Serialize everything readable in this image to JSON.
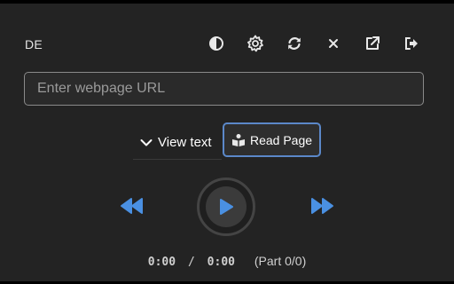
{
  "header": {
    "language": "DE"
  },
  "toolbar": {
    "buttons": [
      {
        "name": "theme-toggle",
        "icon": "contrast-icon"
      },
      {
        "name": "settings",
        "icon": "gear-icon"
      },
      {
        "name": "reload",
        "icon": "refresh-icon"
      },
      {
        "name": "close",
        "icon": "close-icon"
      },
      {
        "name": "open-external",
        "icon": "external-link-icon"
      },
      {
        "name": "sign-out",
        "icon": "sign-out-icon"
      }
    ]
  },
  "url_input": {
    "placeholder": "Enter webpage URL",
    "value": ""
  },
  "controls": {
    "view_text_label": "View text",
    "read_page_label": "Read Page"
  },
  "player": {
    "current_time": "0:00",
    "separator": "/",
    "total_time": "0:00",
    "part_label": "(Part 0/0)"
  },
  "colors": {
    "accent": "#4a90e2",
    "background": "#232323",
    "read_page_border": "#5b88c9"
  }
}
